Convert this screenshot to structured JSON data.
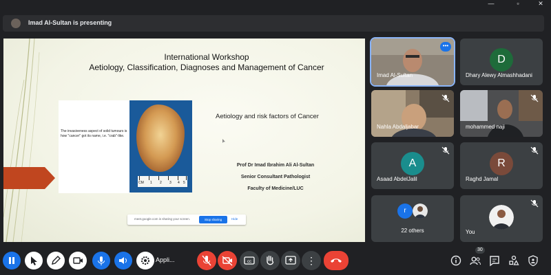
{
  "window": {
    "minimize": "—",
    "maximize": "▫",
    "close": "✕"
  },
  "presenting": {
    "text": "Imad Al-Sultan is presenting"
  },
  "slide": {
    "title_line1": "International Workshop",
    "title_line2": "Aetiology, Classification, Diagnoses and Management of Cancer",
    "image_caption": "The invasiveness aspect of solid tumours is how \"cancer\" got its name, i.e. \"crab\"-like.",
    "ruler_labels": [
      "CM",
      "1",
      "2",
      "3",
      "4",
      "5"
    ],
    "subtitle": "Aetiology and risk factors of Cancer",
    "author_name": "Prof Dr Imad Ibrahim Ali Al-Sultan",
    "author_role": "Senior Consultant Pathologist",
    "author_affiliation": "Faculty of Medicine/LUC"
  },
  "share_notice": {
    "text": "meet.google.com is sharing your screen.",
    "stop_label": "Stop sharing",
    "hide_label": "Hide"
  },
  "participants": [
    {
      "name": "Imad Al-Sultan",
      "type": "video"
    },
    {
      "name": "Dhary Alewy Almashhadani",
      "initial": "D",
      "avatar_color": "#1e6b3a"
    },
    {
      "name": "Nahla Abdaljabar",
      "type": "video"
    },
    {
      "name": "mohammed naji",
      "type": "video"
    },
    {
      "name": "Asaad AbdelJalil",
      "initial": "A",
      "avatar_color": "#1a8d8d"
    },
    {
      "name": "Raghd Jamal",
      "initial": "R",
      "avatar_color": "#7a4a3a"
    },
    {
      "name": "22 others",
      "initial": "r",
      "avatar_color": "#1a73e8"
    },
    {
      "name": "You",
      "type": "video"
    }
  ],
  "toolbar": {
    "taskbar_text": "Appli...",
    "more_options": "⋮",
    "participants_count": "30"
  },
  "colors": {
    "background": "#202124",
    "tile": "#3c4043",
    "accent": "#1a73e8",
    "end_call": "#ea4335",
    "mic_off": "#ea4335"
  }
}
